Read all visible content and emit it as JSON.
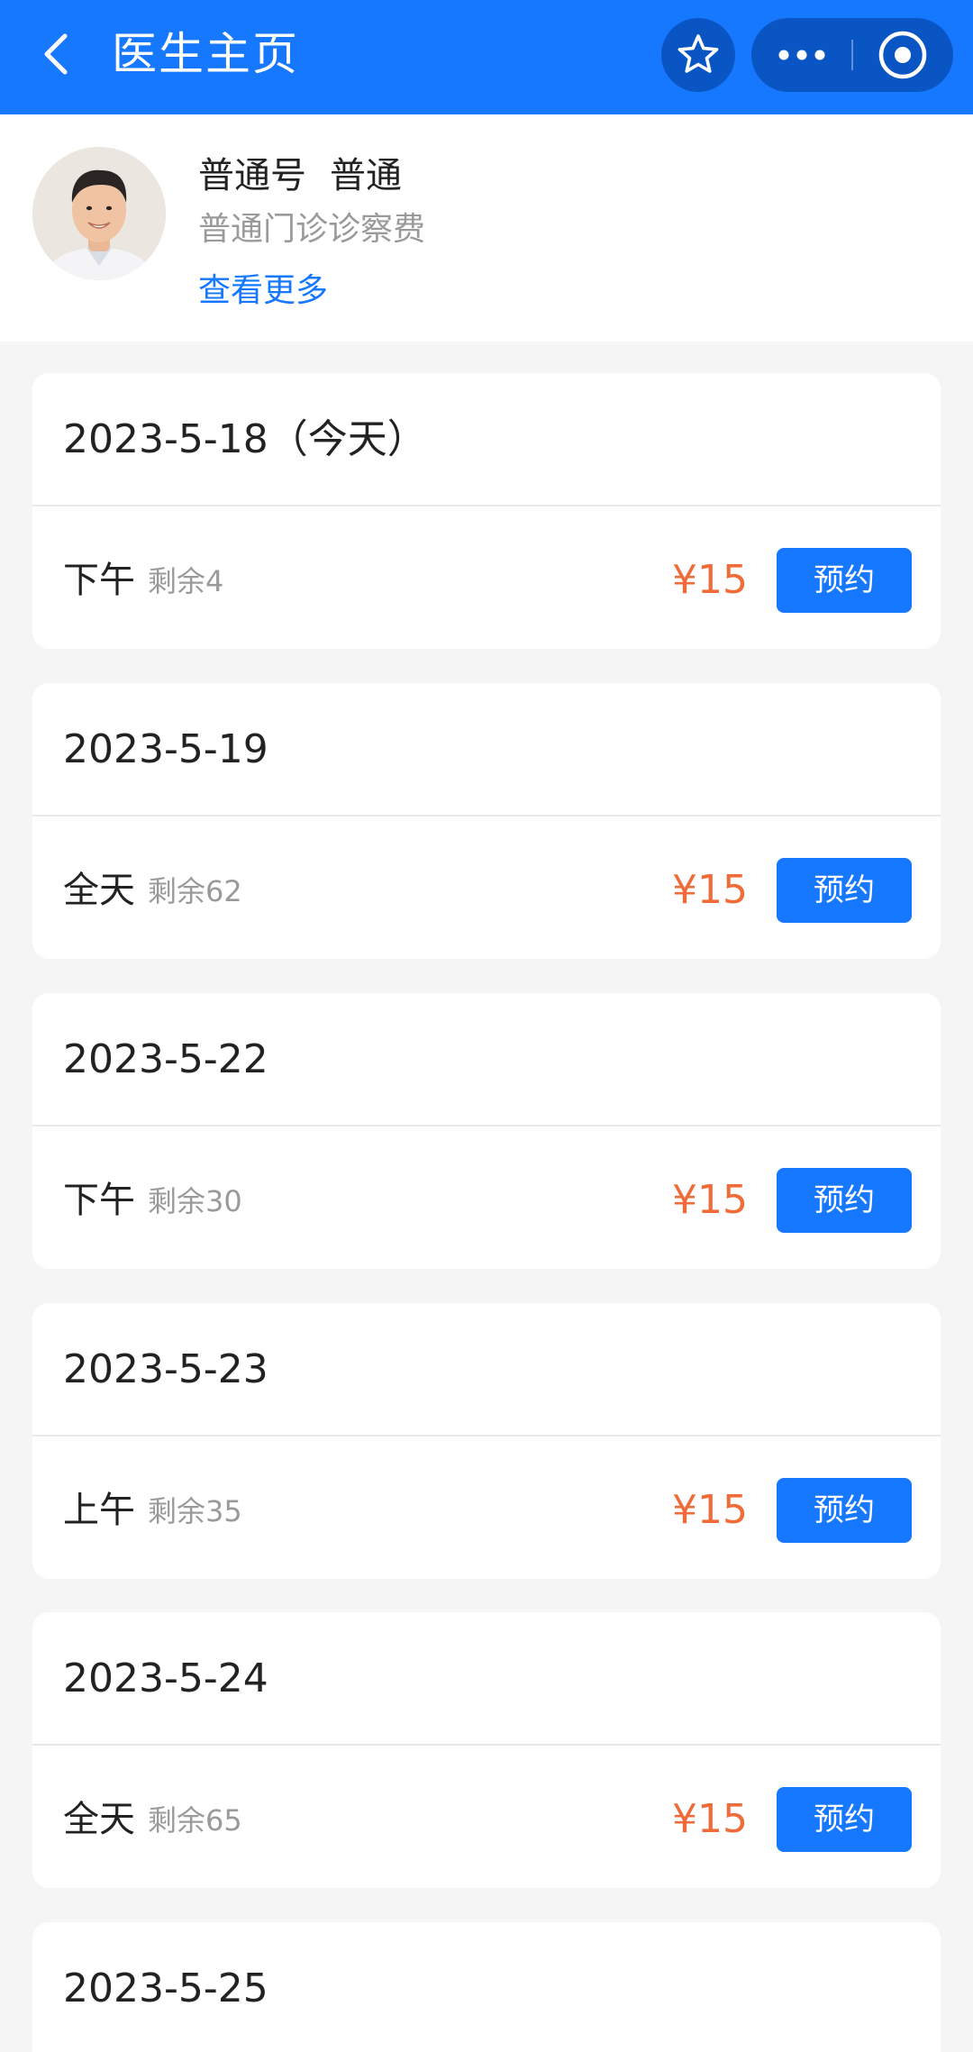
{
  "navbar": {
    "title": "医生主页"
  },
  "doctor": {
    "type": "普通号",
    "level": "普通",
    "description": "普通门诊诊察费",
    "more_link": "查看更多"
  },
  "schedules": [
    {
      "date": "2023-5-18（今天）",
      "slot": "下午",
      "remaining": "剩余4",
      "price": "¥15",
      "button": "预约"
    },
    {
      "date": "2023-5-19",
      "slot": "全天",
      "remaining": "剩余62",
      "price": "¥15",
      "button": "预约"
    },
    {
      "date": "2023-5-22",
      "slot": "下午",
      "remaining": "剩余30",
      "price": "¥15",
      "button": "预约"
    },
    {
      "date": "2023-5-23",
      "slot": "上午",
      "remaining": "剩余35",
      "price": "¥15",
      "button": "预约"
    },
    {
      "date": "2023-5-24",
      "slot": "全天",
      "remaining": "剩余65",
      "price": "¥15",
      "button": "预约"
    },
    {
      "date": "2023-5-25"
    }
  ],
  "colors": {
    "primary": "#1677ff",
    "price": "#f06b3a",
    "muted": "#9a9a9a",
    "background": "#f5f5f5"
  },
  "icons": {
    "back": "chevron-left-icon",
    "favorite": "star-icon",
    "more": "more-dots-icon",
    "close": "target-circle-icon"
  }
}
